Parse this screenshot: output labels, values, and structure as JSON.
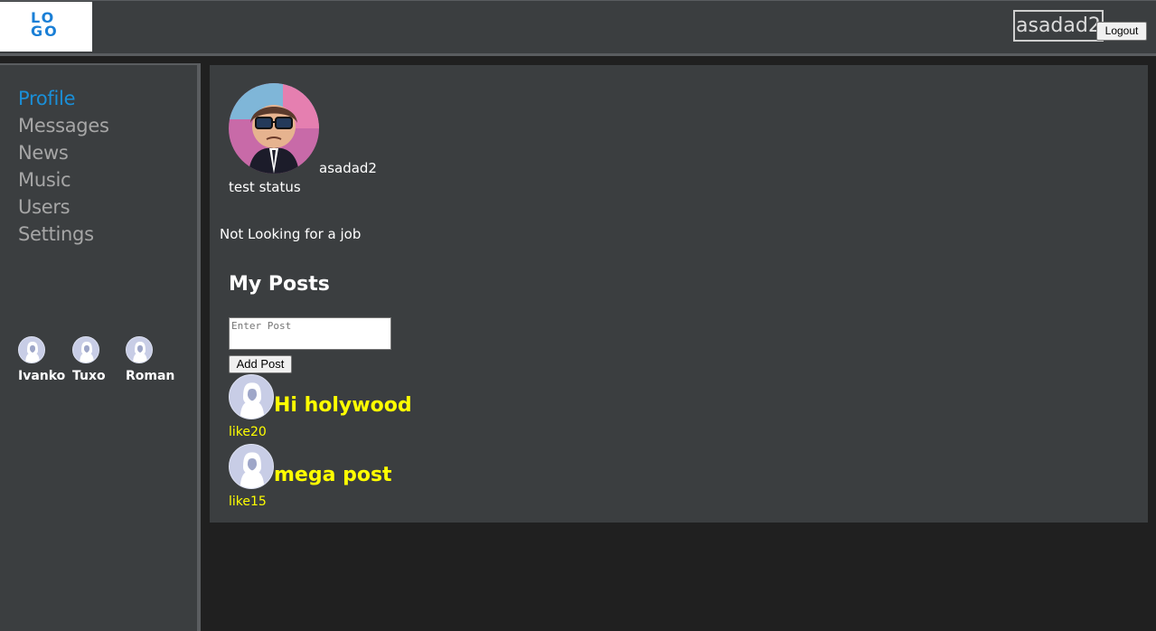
{
  "header": {
    "logo_text": "LO GO",
    "login_name": "asadad2",
    "logout_label": "Logout"
  },
  "sidebar": {
    "items": [
      {
        "label": "Profile",
        "active": true
      },
      {
        "label": "Messages",
        "active": false
      },
      {
        "label": "News",
        "active": false
      },
      {
        "label": "Music",
        "active": false
      },
      {
        "label": "Users",
        "active": false
      },
      {
        "label": "Settings",
        "active": false
      }
    ],
    "friends": [
      {
        "name": "Ivanko",
        "icon": "user-avatar-icon"
      },
      {
        "name": "Tuxo",
        "icon": "user-avatar-icon"
      },
      {
        "name": "Roman",
        "icon": "user-avatar-icon"
      }
    ]
  },
  "profile": {
    "username": "asadad2",
    "status": "test status",
    "job": "Not Looking for a job",
    "avatar_icon": "profile-avatar-icon"
  },
  "posts": {
    "title": "My Posts",
    "input_placeholder": "Enter Post",
    "add_label": "Add Post",
    "items": [
      {
        "text": "Hi holywood",
        "like": "like20"
      },
      {
        "text": "mega post",
        "like": "like15"
      }
    ]
  },
  "colors": {
    "accent": "#1a8fd8",
    "post_text": "#ffff00",
    "panel": "#3b3e40",
    "background": "#202020"
  }
}
